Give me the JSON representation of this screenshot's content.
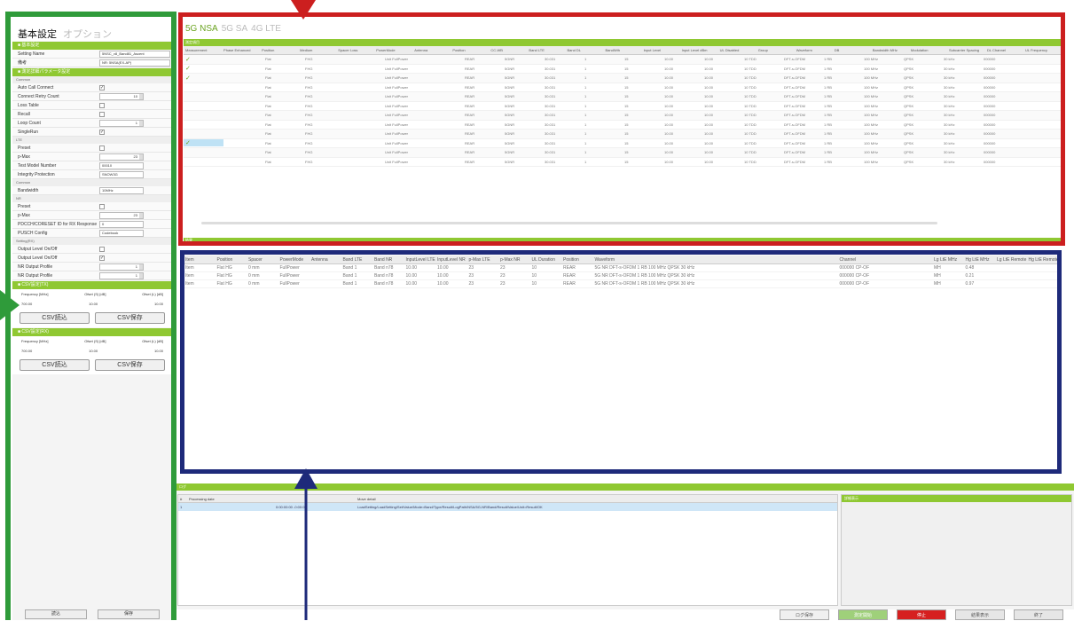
{
  "left_panel": {
    "tabs": [
      "基本設定",
      "オプション"
    ],
    "section_bars": [
      "■ 基本設定",
      "■ 測定詳細パラメータ設定",
      "■ CSV設定(TX)",
      "■ CSV設定(RX)"
    ],
    "basic_rows": [
      {
        "label": "Setting Name",
        "value": "5NSC_v8_Band81_Ascent"
      },
      {
        "label": "備考",
        "value": "NR: 5NSA(EX-AP)"
      }
    ],
    "rows": [
      {
        "kind": "sec",
        "label": "Common"
      },
      {
        "kind": "check",
        "label": "Auto Call Connect",
        "value": "✓"
      },
      {
        "kind": "spin",
        "label": "Connect Retry Count",
        "value": "10"
      },
      {
        "kind": "check",
        "label": "Loss Table",
        "value": ""
      },
      {
        "kind": "check",
        "label": "Recall",
        "value": ""
      },
      {
        "kind": "spin",
        "label": "Loop Count",
        "value": "1"
      },
      {
        "kind": "check",
        "label": "SingleRun",
        "value": "✓"
      },
      {
        "kind": "sec",
        "label": "LTE"
      },
      {
        "kind": "check",
        "label": "Preset",
        "value": ""
      },
      {
        "kind": "spin",
        "label": "p-Max",
        "value": "23"
      },
      {
        "kind": "field",
        "label": "Test Model Number",
        "value": "00010"
      },
      {
        "kind": "field",
        "label": "Integrity Protection",
        "value": "SNOW3G"
      },
      {
        "kind": "sec",
        "label": "Common"
      },
      {
        "kind": "field",
        "label": "Bandwidth",
        "value": "10MHz"
      },
      {
        "kind": "sec",
        "label": "NR"
      },
      {
        "kind": "check",
        "label": "Preset",
        "value": ""
      },
      {
        "kind": "spin",
        "label": "p-Max",
        "value": "23"
      },
      {
        "kind": "field",
        "label": "PDCCH/CORESET ID for RX Response",
        "value": "0"
      },
      {
        "kind": "field",
        "label": "PUSCH Config",
        "value": "Codebook"
      },
      {
        "kind": "sec",
        "label": "Setting(RX)"
      },
      {
        "kind": "check",
        "label": "Output Level On/Off",
        "value": ""
      },
      {
        "kind": "check",
        "label": "Output Level On/Off",
        "value": "✓"
      },
      {
        "kind": "spin",
        "label": "NR Output Profile",
        "value": "1"
      },
      {
        "kind": "spin",
        "label": "NR Output Profile",
        "value": "1"
      }
    ],
    "tx_table": {
      "headers": [
        "Frequency [MHz]",
        "Ofset (S) [dB]",
        "Ofset (L) [dB]"
      ],
      "values": [
        "700.00",
        "10.00",
        "10.00"
      ]
    },
    "rx_table": {
      "headers": [
        "Frequency [MHz]",
        "Ofset (S) [dB]",
        "Ofset (L) [dB]"
      ],
      "values": [
        "700.00",
        "10.00",
        "10.00"
      ]
    },
    "csv_load": "CSV読込",
    "csv_save": "CSV保存",
    "bottom_buttons": [
      "読込",
      "保存"
    ]
  },
  "top_area": {
    "tabs": [
      "5G NSA",
      "5G SA",
      "4G LTE"
    ],
    "bar_label": "測定項目",
    "bottom_bar_label": "結果",
    "headers": [
      "Measurement",
      "Phase Enhanced",
      "Position",
      "Medium",
      "Spacer Loss",
      "PowerMode",
      "Antenna",
      "Position",
      "CC-WB",
      "Band LTE",
      "Band DL",
      "BandWth",
      "Input Level",
      "Input Level dBm",
      "UL Disabled",
      "Group",
      "Waveform",
      "DB",
      "Bandwidth MHz",
      "Modulation",
      "Subcarrier Spacing",
      "DL Channel",
      "UL Frequency"
    ],
    "rows": [
      [
        "✓",
        "",
        "Flat",
        "FHG",
        "",
        "Unit FullPower",
        "",
        "REAR",
        "5GNR",
        "30.031",
        "1",
        "15",
        "10.00",
        "10.00",
        "10 TDD",
        "DFT-s-OFDM",
        "1 RB",
        "100 MHz",
        "QPSK",
        "30 kHz",
        "000000",
        ""
      ],
      [
        "✓",
        "",
        "Flat",
        "FHG",
        "",
        "Unit FullPower",
        "",
        "REAR",
        "5GNR",
        "30.031",
        "1",
        "15",
        "10.00",
        "10.00",
        "10 TDD",
        "DFT-s-OFDM",
        "1 RB",
        "100 MHz",
        "QPSK",
        "30 kHz",
        "000000",
        ""
      ],
      [
        "✓",
        "",
        "Flat",
        "FHG",
        "",
        "Unit FullPower",
        "",
        "REAR",
        "5GNR",
        "30.031",
        "1",
        "15",
        "10.00",
        "10.00",
        "10 TDD",
        "DFT-s-OFDM",
        "1 RB",
        "100 MHz",
        "QPSK",
        "30 kHz",
        "000000",
        ""
      ],
      [
        "",
        "",
        "Flat",
        "FHG",
        "",
        "Unit FullPower",
        "",
        "REAR",
        "5GNR",
        "30.031",
        "1",
        "15",
        "10.00",
        "10.00",
        "10 TDD",
        "DFT-s-OFDM",
        "1 RB",
        "100 MHz",
        "QPSK",
        "30 kHz",
        "000000",
        ""
      ],
      [
        "",
        "",
        "Flat",
        "FHG",
        "",
        "Unit FullPower",
        "",
        "REAR",
        "5GNR",
        "30.031",
        "1",
        "15",
        "10.00",
        "10.00",
        "10 TDD",
        "DFT-s-OFDM",
        "1 RB",
        "100 MHz",
        "QPSK",
        "30 kHz",
        "000000",
        ""
      ],
      [
        "",
        "",
        "Flat",
        "FHG",
        "",
        "Unit FullPower",
        "",
        "REAR",
        "5GNR",
        "30.031",
        "1",
        "15",
        "10.00",
        "10.00",
        "10 TDD",
        "DFT-s-OFDM",
        "1 RB",
        "100 MHz",
        "QPSK",
        "30 kHz",
        "000000",
        ""
      ],
      [
        "",
        "",
        "Flat",
        "FHG",
        "",
        "Unit FullPower",
        "",
        "REAR",
        "5GNR",
        "30.031",
        "1",
        "15",
        "10.00",
        "10.00",
        "10 TDD",
        "DFT-s-OFDM",
        "1 RB",
        "100 MHz",
        "QPSK",
        "30 kHz",
        "000000",
        ""
      ],
      [
        "",
        "",
        "Flat",
        "FHG",
        "",
        "Unit FullPower",
        "",
        "REAR",
        "5GNR",
        "30.031",
        "1",
        "15",
        "10.00",
        "10.00",
        "10 TDD",
        "DFT-s-OFDM",
        "1 RB",
        "100 MHz",
        "QPSK",
        "30 kHz",
        "000000",
        ""
      ],
      [
        "",
        "",
        "Flat",
        "FHG",
        "",
        "Unit FullPower",
        "",
        "REAR",
        "5GNR",
        "30.031",
        "1",
        "15",
        "10.00",
        "10.00",
        "10 TDD",
        "DFT-s-OFDM",
        "1 RB",
        "100 MHz",
        "QPSK",
        "30 kHz",
        "000000",
        ""
      ],
      [
        "✓",
        "",
        "Flat",
        "FHG",
        "",
        "Unit FullPower",
        "",
        "REAR",
        "5GNR",
        "30.031",
        "1",
        "15",
        "10.00",
        "10.00",
        "10 TDD",
        "DFT-s-OFDM",
        "1 RB",
        "100 MHz",
        "QPSK",
        "30 kHz",
        "000000",
        ""
      ],
      [
        "",
        "",
        "Flat",
        "FHG",
        "",
        "Unit FullPower",
        "",
        "REAR",
        "5GNR",
        "30.031",
        "1",
        "15",
        "10.00",
        "10.00",
        "10 TDD",
        "DFT-s-OFDM",
        "1 RB",
        "100 MHz",
        "QPSK",
        "30 kHz",
        "000000",
        ""
      ],
      [
        "",
        "",
        "Flat",
        "FHG",
        "",
        "Unit FullPower",
        "",
        "REAR",
        "5GNR",
        "30.031",
        "1",
        "15",
        "10.00",
        "10.00",
        "10 TDD",
        "DFT-s-OFDM",
        "1 RB",
        "100 MHz",
        "QPSK",
        "30 kHz",
        "000000",
        ""
      ]
    ]
  },
  "mid_area": {
    "headers": [
      "Item",
      "Position",
      "Spacer",
      "PowerMode",
      "Antenna",
      "Band LTE",
      "Band NR",
      "InputLevel LTE",
      "InputLevel NR",
      "p-Max LTE",
      "p-Max NR",
      "UL Duration",
      "Position",
      "Waveform",
      "",
      "",
      "",
      "Channel",
      "",
      "",
      "Lg LtE MHz",
      "Hg LtE MHz",
      "Lg LtE Remote",
      "Hg LtE Remote"
    ],
    "rows": [
      [
        "Item",
        "Flat HG",
        "0 mm",
        "FullPower",
        "",
        "Band 1",
        "Band n78",
        "10.00",
        "10.00",
        "23",
        "23",
        "10",
        "REAR",
        "5G NR DFT-s-OFDM 1 RB 100 MHz QPSK 30 kHz",
        "",
        "",
        "",
        "000000 CP-OFDM MHz",
        "",
        "",
        "MH",
        "0.48",
        "",
        ""
      ],
      [
        "Item",
        "Flat HG",
        "0 mm",
        "FullPower",
        "",
        "Band 1",
        "Band n78",
        "10.00",
        "10.00",
        "23",
        "23",
        "10",
        "REAR",
        "5G NR DFT-s-OFDM 1 RB 100 MHz QPSK 30 kHz",
        "",
        "",
        "",
        "000000 CP-OFDM MHz",
        "",
        "",
        "MH",
        "0.21",
        "",
        ""
      ],
      [
        "Item",
        "Flat HG",
        "0 mm",
        "FullPower",
        "",
        "Band 1",
        "Band n78",
        "10.00",
        "10.00",
        "23",
        "23",
        "10",
        "REAR",
        "5G NR DFT-s-OFDM 1 RB 100 MHz QPSK 30 kHz",
        "",
        "",
        "",
        "000000 CP-OFDM MHz",
        "",
        "",
        "MH",
        "0.97",
        "",
        ""
      ]
    ]
  },
  "log_area": {
    "bar_label": "ログ",
    "headers": [
      "#",
      "Processing date",
      "Move detail"
    ],
    "row": [
      "1",
      "0:00:00:00 -0:00:00",
      "LoadSetting/LoadSetting/Set/Value/Mode=Band/Type/Result/LogPath/NSA/5G-NR/Band/Result/Value/Unit=Result/OK"
    ],
    "side_label": "詳細表示"
  },
  "bottom_buttons": [
    {
      "label": "ログ保存",
      "bg": "#f0f0f0"
    },
    {
      "label": "測定開始",
      "bg": "#9fd07a"
    },
    {
      "label": "停止",
      "bg": "#d62020"
    },
    {
      "label": "結果表示",
      "bg": "#e6e6e6"
    },
    {
      "label": "終了",
      "bg": "#e6e6e6"
    }
  ],
  "annotation_colors": {
    "green": "#2f9b3a",
    "red": "#cc1f1f",
    "blue": "#1e2a7a"
  }
}
